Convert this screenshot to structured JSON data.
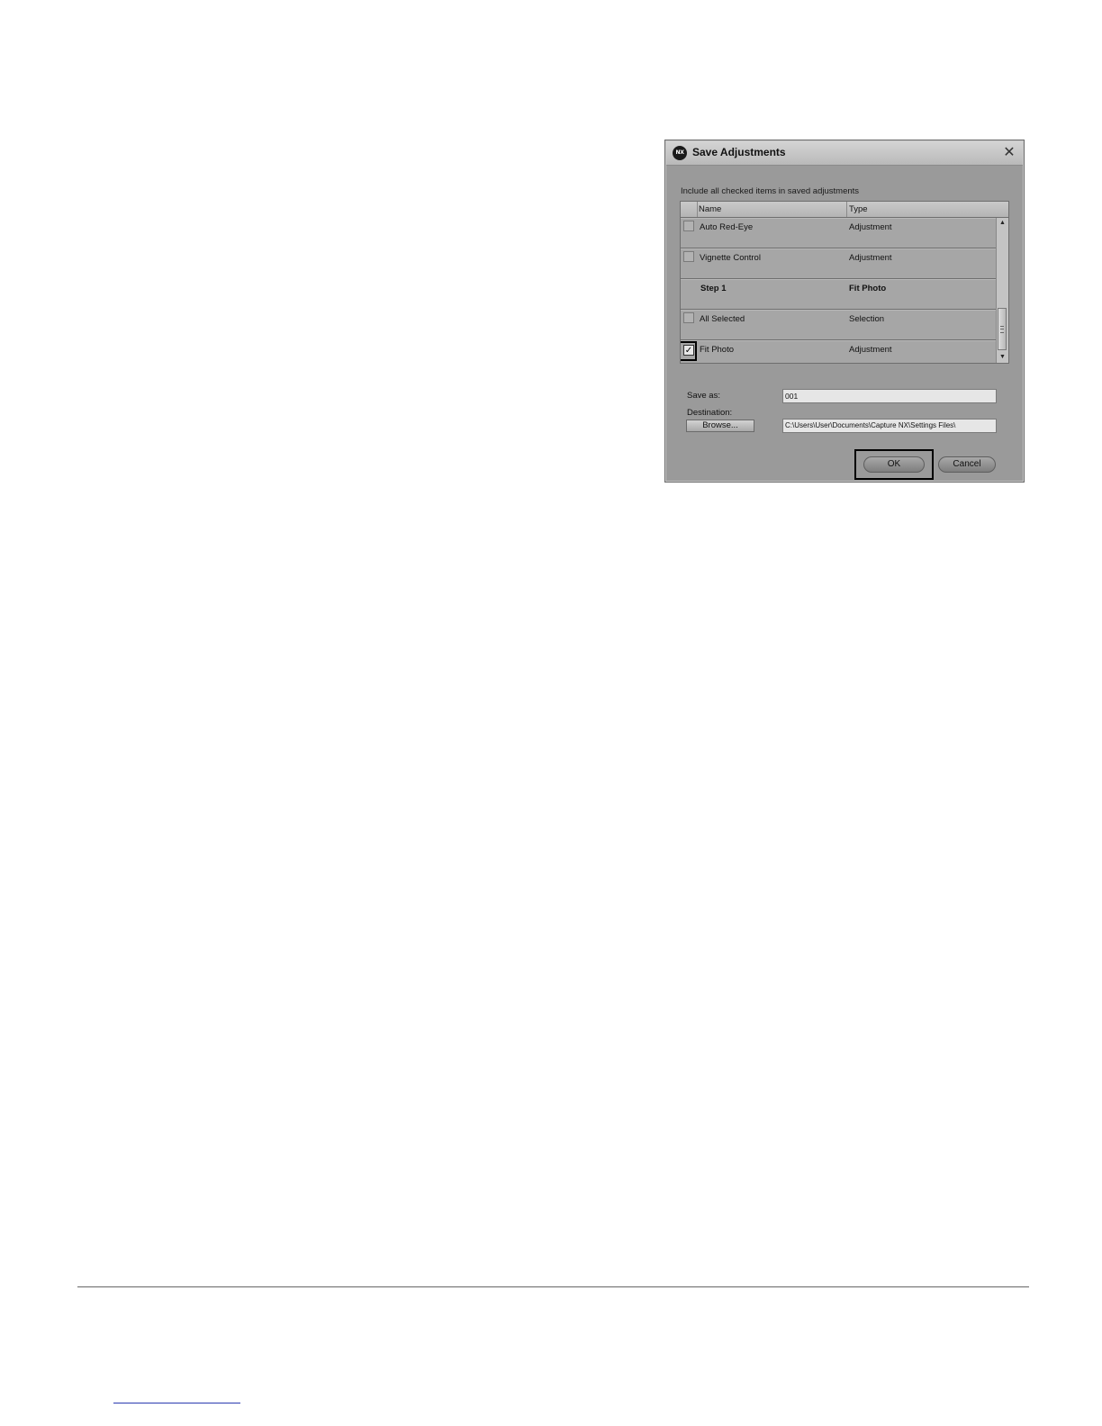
{
  "dialog": {
    "app_logo_text": "NX",
    "title": "Save Adjustments",
    "close_glyph": "✕",
    "instruction": "Include all checked items in saved adjustments",
    "table": {
      "headers": {
        "name": "Name",
        "type": "Type"
      },
      "rows": [
        {
          "name": "Auto Red-Eye",
          "type": "Adjustment",
          "checked": false
        },
        {
          "name": "Vignette Control",
          "type": "Adjustment",
          "checked": false
        },
        {
          "name": "Step 1",
          "type": "Fit Photo",
          "checked": null
        },
        {
          "name": "All Selected",
          "type": "Selection",
          "checked": false
        },
        {
          "name": "Fit Photo",
          "type": "Adjustment",
          "checked": true
        }
      ],
      "check_glyph": "✓",
      "scroll_up_glyph": "▲",
      "scroll_down_glyph": "▼"
    },
    "save_as": {
      "label": "Save as:",
      "value": "001"
    },
    "destination": {
      "label": "Destination:",
      "browse_label": "Browse...",
      "value": "C:\\Users\\User\\Documents\\Capture NX\\Settings Files\\"
    },
    "buttons": {
      "ok": "OK",
      "cancel": "Cancel"
    }
  },
  "icons": {
    "app_logo": "capture-nx-logo-icon",
    "close": "close-icon",
    "check": "checkmark-icon"
  }
}
